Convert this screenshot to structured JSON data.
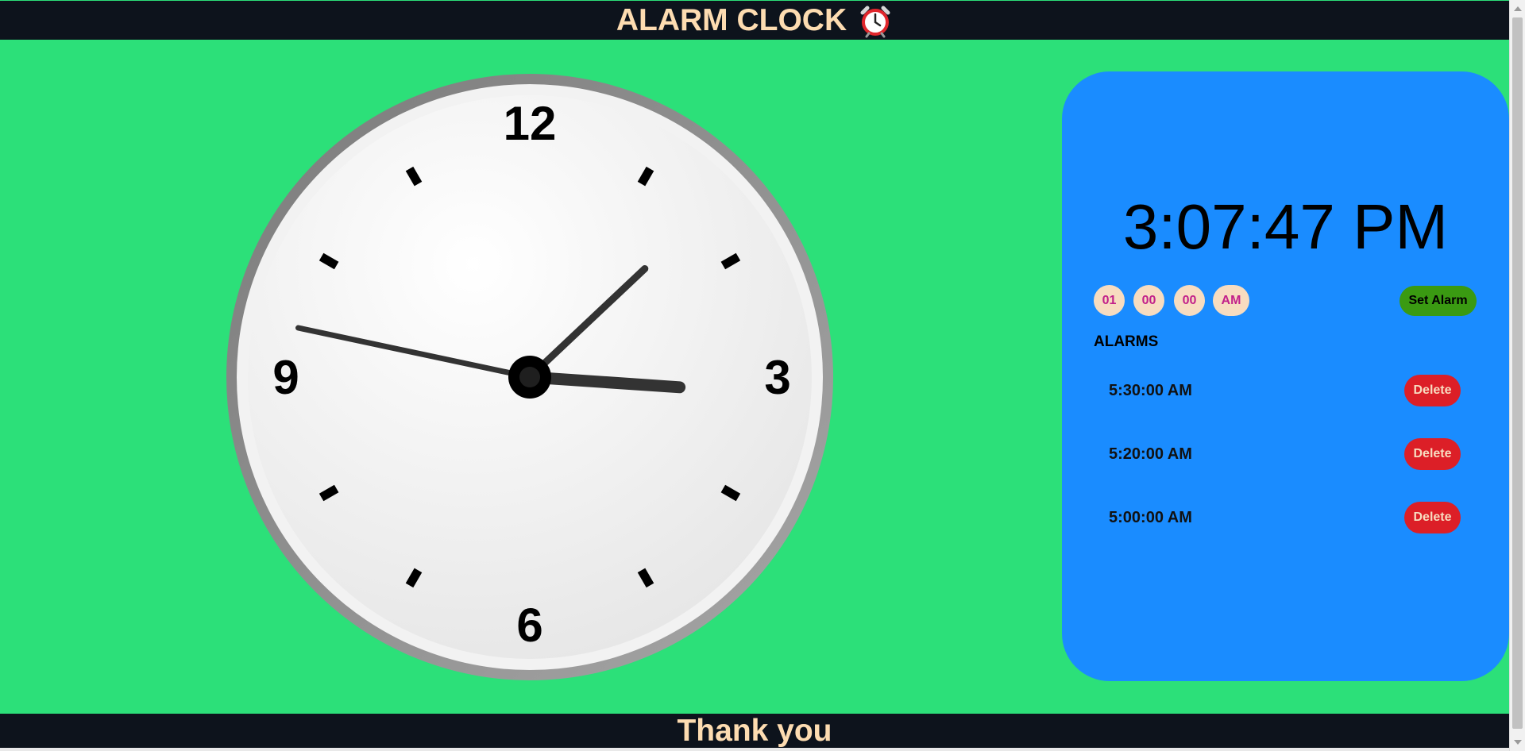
{
  "header": {
    "title": "ALARM CLOCK",
    "icon": "alarm-clock-icon"
  },
  "analog_clock": {
    "numerals": {
      "twelve": "12",
      "three": "3",
      "six": "6",
      "nine": "9"
    },
    "time": {
      "hours": 15,
      "minutes": 7,
      "seconds": 47
    }
  },
  "panel": {
    "current_time": "3:07:47 PM",
    "selector": {
      "hour": "01",
      "minute": "00",
      "second": "00",
      "ampm": "AM"
    },
    "set_alarm_label": "Set Alarm",
    "alarms_title": "ALARMS",
    "alarms": [
      {
        "time": "5:30:00 AM",
        "delete_label": "Delete"
      },
      {
        "time": "5:20:00 AM",
        "delete_label": "Delete"
      },
      {
        "time": "5:00:00 AM",
        "delete_label": "Delete"
      }
    ]
  },
  "footer": {
    "text": "Thank you"
  },
  "colors": {
    "background": "#2ce079",
    "bar": "#0d131c",
    "bar_text": "#fddcb1",
    "panel": "#1a8cff",
    "set_alarm": "#3a9a12",
    "delete": "#dc1f27",
    "pill": "#f7dcc0",
    "pill_text": "#c2208a"
  }
}
